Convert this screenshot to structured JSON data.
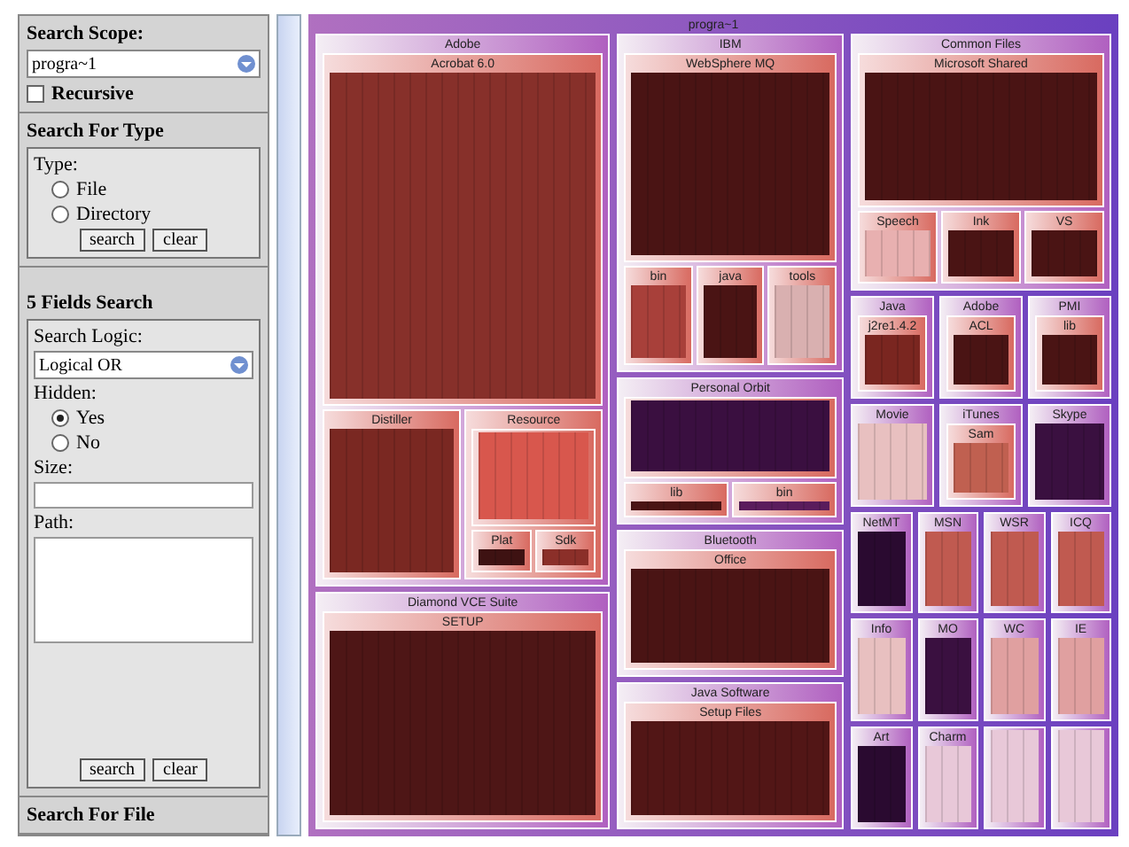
{
  "scope": {
    "label": "Search Scope:",
    "value": "progra~1",
    "recursive": {
      "label": "Recursive",
      "checked": false
    }
  },
  "type_search": {
    "title": "Search For Type",
    "group": "Type:",
    "options": [
      {
        "label": "File",
        "selected": false
      },
      {
        "label": "Directory",
        "selected": false
      }
    ],
    "buttons": [
      "search",
      "clear"
    ]
  },
  "field_search": {
    "title": "5 Fields Search",
    "logic_label": "Search Logic:",
    "logic": "Logical OR",
    "hidden_label": "Hidden:",
    "hidden_options": [
      {
        "label": "Yes",
        "selected": true
      },
      {
        "label": "No",
        "selected": false
      }
    ],
    "size_label": "Size:",
    "path_label": "Path:",
    "buttons": [
      "search",
      "clear"
    ]
  },
  "file_search": {
    "title": "Search For File"
  },
  "treemap": {
    "title": "progra~1",
    "columns": [
      {
        "items": [
          {
            "kind": "node",
            "label": "Adobe",
            "children": [
              {
                "label": "Acrobat 6.0",
                "color": "#87302a"
              },
              {
                "label": "Distiller",
                "color": "#7a2822"
              },
              {
                "label": "Resource",
                "children": [
                  {
                    "color": "#d8574d"
                  },
                  {
                    "label": "Plat",
                    "color": "#3e1212"
                  },
                  {
                    "label": "Sdk",
                    "color": "#8b2f29"
                  }
                ]
              }
            ]
          },
          {
            "kind": "node",
            "label": "Diamond VCE Suite",
            "children": [
              {
                "label": "SETUP",
                "color": "#4e1616"
              }
            ]
          }
        ]
      },
      {
        "items": [
          {
            "kind": "node",
            "label": "IBM",
            "children": [
              {
                "label": "WebSphere MQ",
                "color": "#4a1414"
              },
              {
                "label": "bin",
                "color": "#a8403a"
              },
              {
                "label": "java",
                "color": "#4a1414"
              },
              {
                "label": "tools",
                "color": "#d9b0b0"
              }
            ]
          },
          {
            "kind": "node",
            "label": "Personal Orbit",
            "children": [
              {
                "color": "#3a0f40"
              },
              {
                "label": "lib",
                "color": "#4a1414"
              },
              {
                "label": "bin",
                "color": "#5a1c5c"
              }
            ]
          },
          {
            "kind": "node",
            "label": "Bluetooth",
            "children": [
              {
                "label": "Office",
                "color": "#4a1414"
              }
            ]
          },
          {
            "kind": "node",
            "label": "Java Software",
            "children": [
              {
                "label": "Setup Files",
                "color": "#521616"
              }
            ]
          }
        ]
      },
      {
        "items": [
          {
            "kind": "node",
            "label": "Common Files",
            "children": [
              {
                "label": "Microsoft Shared",
                "color": "#4a1414"
              },
              {
                "label": "Speech",
                "color": "#e8b0b0"
              },
              {
                "label": "Ink",
                "color": "#4a1414"
              },
              {
                "label": "VS",
                "color": "#4a1414"
              }
            ]
          },
          {
            "kind": "row",
            "nodes": [
              {
                "label": "Java",
                "children": [
                  {
                    "label": "j2re1.4.2",
                    "color": "#7a2620"
                  }
                ]
              },
              {
                "label": "Adobe",
                "children": [
                  {
                    "label": "ACL",
                    "color": "#4a1414"
                  }
                ]
              },
              {
                "label": "PMI",
                "children": [
                  {
                    "label": "lib",
                    "color": "#4a1414"
                  }
                ]
              }
            ]
          },
          {
            "kind": "row",
            "nodes": [
              {
                "label": "Movie",
                "color": "#e8c0c0"
              },
              {
                "label": "iTunes",
                "children": [
                  {
                    "label": "Sam",
                    "color": "#c06050"
                  }
                ]
              },
              {
                "label": "Skype",
                "color": "#3a1040"
              }
            ]
          },
          {
            "kind": "row",
            "nodes": [
              {
                "label": "NetMT",
                "color": "#2a0a30"
              },
              {
                "label": "MSN",
                "color": "#c05a50"
              },
              {
                "label": "WSR",
                "color": "#c05a50"
              },
              {
                "label": "ICQ",
                "color": "#c05a50"
              }
            ]
          },
          {
            "kind": "row",
            "nodes": [
              {
                "label": "Info",
                "color": "#e8c0c0"
              },
              {
                "label": "MO",
                "color": "#3a1040"
              },
              {
                "label": "WC",
                "color": "#e0a0a0"
              },
              {
                "label": "IE",
                "color": "#e0a0a0"
              }
            ]
          },
          {
            "kind": "row",
            "nodes": [
              {
                "label": "Art",
                "color": "#2a0a30"
              },
              {
                "label": "Charm",
                "color": "#e8c8d8"
              },
              {
                "color": "#e8c8d8"
              },
              {
                "color": "#e8c8d8"
              }
            ]
          }
        ]
      }
    ]
  }
}
